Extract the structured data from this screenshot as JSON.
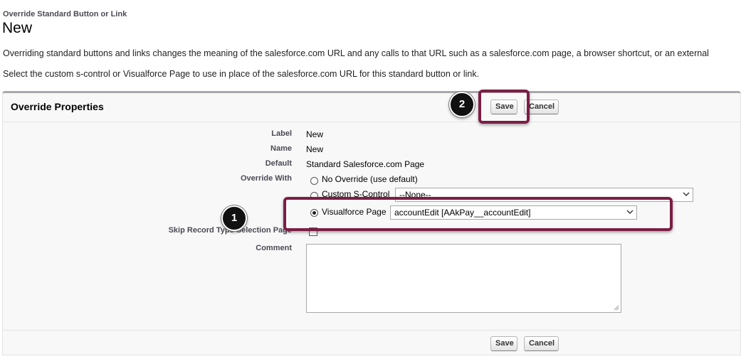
{
  "header": {
    "breadcrumb": "Override Standard Button or Link",
    "title": "New",
    "intro_1": "Overriding standard buttons and links changes the meaning of the salesforce.com URL and any calls to that URL such as a salesforce.com page, a browser shortcut, or an external",
    "intro_2": "Select the custom s-control or Visualforce Page to use in place of the salesforce.com URL for this standard button or link."
  },
  "panel": {
    "title": "Override Properties",
    "save_label": "Save",
    "cancel_label": "Cancel"
  },
  "fields": {
    "label_label": "Label",
    "label_value": "New",
    "name_label": "Name",
    "name_value": "New",
    "default_label": "Default",
    "default_value": "Standard Salesforce.com Page",
    "override_label": "Override With",
    "option_no_override": "No Override (use default)",
    "option_scontrol": "Custom S-Control",
    "scontrol_select_value": "--None--",
    "option_visualforce": "Visualforce Page",
    "visualforce_select_value": "accountEdit [AAkPay__accountEdit]",
    "selected_option": "Visualforce Page",
    "skip_label": "Skip Record Type Selection Page",
    "comment_label": "Comment",
    "comment_value": ""
  },
  "callouts": {
    "step1": "1",
    "step2": "2"
  },
  "colors": {
    "highlight": "#7b1e45",
    "panel_border_top": "#a7a9ad"
  }
}
